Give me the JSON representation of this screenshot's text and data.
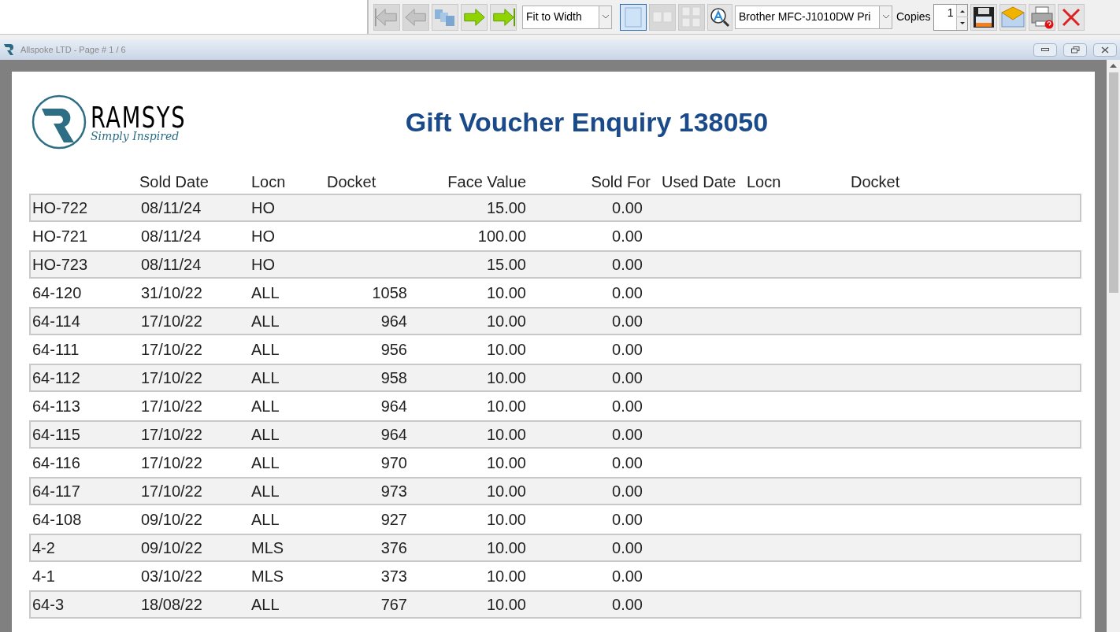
{
  "toolbar": {
    "nav_buttons": [
      {
        "kind": "first",
        "disabled": true
      },
      {
        "kind": "prev",
        "disabled": true
      },
      {
        "kind": "pages",
        "disabled": false
      },
      {
        "kind": "next",
        "disabled": false
      },
      {
        "kind": "last",
        "disabled": false
      }
    ],
    "zoom_select": {
      "value": "Fit to Width"
    },
    "view_buttons": [
      {
        "kind": "single",
        "selected": true,
        "disabled": false
      },
      {
        "kind": "double",
        "selected": false,
        "disabled": true
      },
      {
        "kind": "quad",
        "selected": false,
        "disabled": true
      }
    ],
    "printer_select": {
      "value": "Brother MFC-J1010DW Pri"
    },
    "copies": {
      "label": "Copies",
      "value": "1"
    },
    "action_buttons": [
      {
        "kind": "save"
      },
      {
        "kind": "email"
      },
      {
        "kind": "print"
      },
      {
        "kind": "close"
      }
    ]
  },
  "window": {
    "title": "Allspoke LTD - Page # 1 / 6"
  },
  "report": {
    "logo": {
      "name": "RAMSYS",
      "tagline": "Simply Inspired"
    },
    "title": "Gift Voucher Enquiry 138050",
    "columns": [
      "",
      "Sold Date",
      "Locn",
      "Docket",
      "Face Value",
      "Sold For",
      "Used Date",
      "Locn",
      "Docket"
    ],
    "rows": [
      [
        "HO-722",
        "08/11/24",
        "HO",
        "",
        "15.00",
        "0.00"
      ],
      [
        "HO-721",
        "08/11/24",
        "HO",
        "",
        "100.00",
        "0.00"
      ],
      [
        "HO-723",
        "08/11/24",
        "HO",
        "",
        "15.00",
        "0.00"
      ],
      [
        "64-120",
        "31/10/22",
        "ALL",
        "1058",
        "10.00",
        "0.00"
      ],
      [
        "64-114",
        "17/10/22",
        "ALL",
        "964",
        "10.00",
        "0.00"
      ],
      [
        "64-111",
        "17/10/22",
        "ALL",
        "956",
        "10.00",
        "0.00"
      ],
      [
        "64-112",
        "17/10/22",
        "ALL",
        "958",
        "10.00",
        "0.00"
      ],
      [
        "64-113",
        "17/10/22",
        "ALL",
        "964",
        "10.00",
        "0.00"
      ],
      [
        "64-115",
        "17/10/22",
        "ALL",
        "964",
        "10.00",
        "0.00"
      ],
      [
        "64-116",
        "17/10/22",
        "ALL",
        "970",
        "10.00",
        "0.00"
      ],
      [
        "64-117",
        "17/10/22",
        "ALL",
        "973",
        "10.00",
        "0.00"
      ],
      [
        "64-108",
        "09/10/22",
        "ALL",
        "927",
        "10.00",
        "0.00"
      ],
      [
        "4-2",
        "09/10/22",
        "MLS",
        "376",
        "10.00",
        "0.00"
      ],
      [
        "4-1",
        "03/10/22",
        "MLS",
        "373",
        "10.00",
        "0.00"
      ],
      [
        "64-3",
        "18/08/22",
        "ALL",
        "767",
        "10.00",
        "0.00"
      ]
    ]
  }
}
